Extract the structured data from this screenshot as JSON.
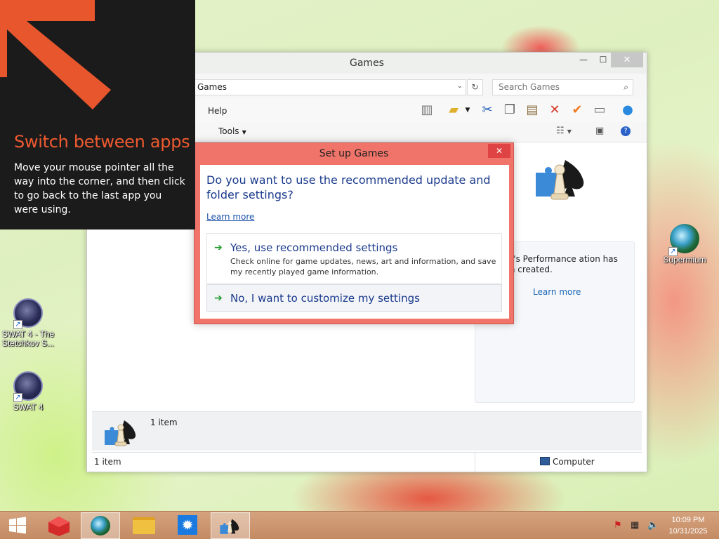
{
  "desktop": {
    "icons": [
      {
        "label": "SWAT 4 - The Stetchkov S..."
      },
      {
        "label": "SWAT 4"
      },
      {
        "label": "Supermium"
      }
    ]
  },
  "hint": {
    "title": "Switch between apps",
    "body": "Move your mouse pointer all the way into the corner, and then click to go back to the last app you were using.",
    "accent_color": "#f05a30"
  },
  "window": {
    "title": "Games",
    "address": "Games",
    "search_placeholder": "Search Games",
    "menu_help": "Help",
    "menu_tools": "Tools",
    "perf_text": "omputer's Performance ation has not been created.",
    "perf_learn_more": "Learn more",
    "details_count": "1 item",
    "status_left": "1 item",
    "status_right": "Computer"
  },
  "dialog": {
    "title": "Set up Games",
    "question": "Do you want to use the recommended update and folder settings?",
    "learn_more": "Learn more",
    "option_yes_label": "Yes, use recommended settings",
    "option_yes_desc": "Check online for game updates, news, art and information, and save my recently played game information.",
    "option_no_label": "No, I want to customize my settings"
  },
  "taskbar": {
    "time": "10:09 PM",
    "date": "10/31/2025",
    "color": "#c9946e"
  }
}
